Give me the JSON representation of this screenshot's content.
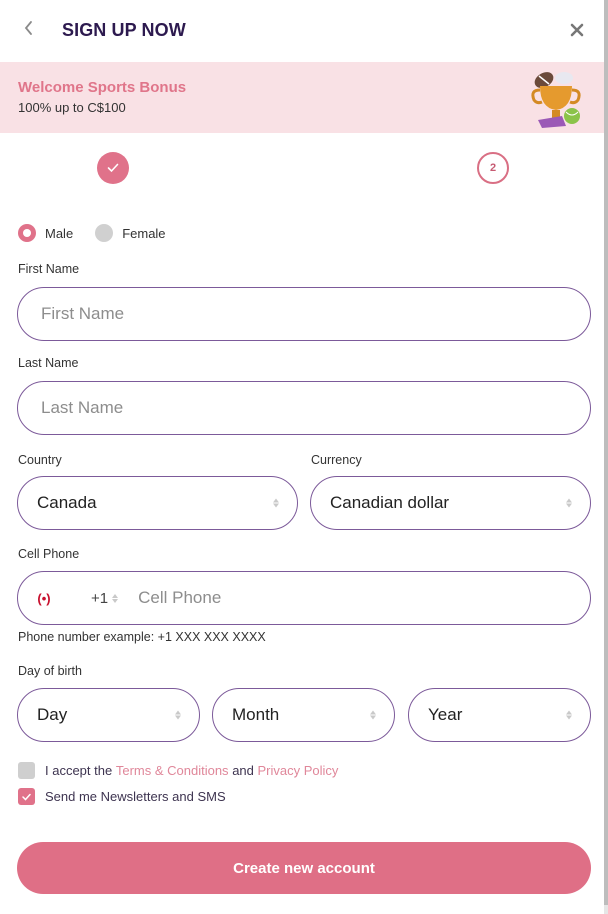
{
  "header": {
    "title": "SIGN UP NOW",
    "back_icon": "chevron-left-icon",
    "close_icon": "close-icon"
  },
  "banner": {
    "title": "Welcome Sports Bonus",
    "subtitle": "100% up to C$100",
    "icon": "trophy-icon"
  },
  "stepper": {
    "steps": [
      {
        "label": "✓",
        "state": "completed"
      },
      {
        "label": "2",
        "state": "current"
      }
    ]
  },
  "gender": {
    "options": [
      {
        "label": "Male",
        "selected": true
      },
      {
        "label": "Female",
        "selected": false
      }
    ]
  },
  "form": {
    "first_name": {
      "label": "First Name",
      "placeholder": "First Name",
      "value": ""
    },
    "last_name": {
      "label": "Last Name",
      "placeholder": "Last Name",
      "value": ""
    },
    "country": {
      "label": "Country",
      "value": "Canada"
    },
    "currency": {
      "label": "Currency",
      "value": "Canadian dollar"
    },
    "cell_phone": {
      "label": "Cell Phone",
      "flag": "canada-flag-icon",
      "flag_glyph": "(•)",
      "country_code": "+1",
      "placeholder": "Cell Phone",
      "hint": "Phone number example: +1 XXX XXX XXXX"
    },
    "birth": {
      "label": "Day of birth",
      "day": "Day",
      "month": "Month",
      "year": "Year"
    }
  },
  "consents": {
    "terms": {
      "checked": false,
      "prefix": "I accept the",
      "terms_link": "Terms & Conditions",
      "middle": "and",
      "privacy_link": "Privacy Policy"
    },
    "newsletter": {
      "checked": true,
      "label": "Send me Newsletters and SMS"
    }
  },
  "submit": {
    "label": "Create new account"
  },
  "colors": {
    "accent": "#df6f86",
    "title": "#2d1a4f",
    "field_border": "#7c5a9a",
    "banner_bg": "#f9e1e5"
  }
}
